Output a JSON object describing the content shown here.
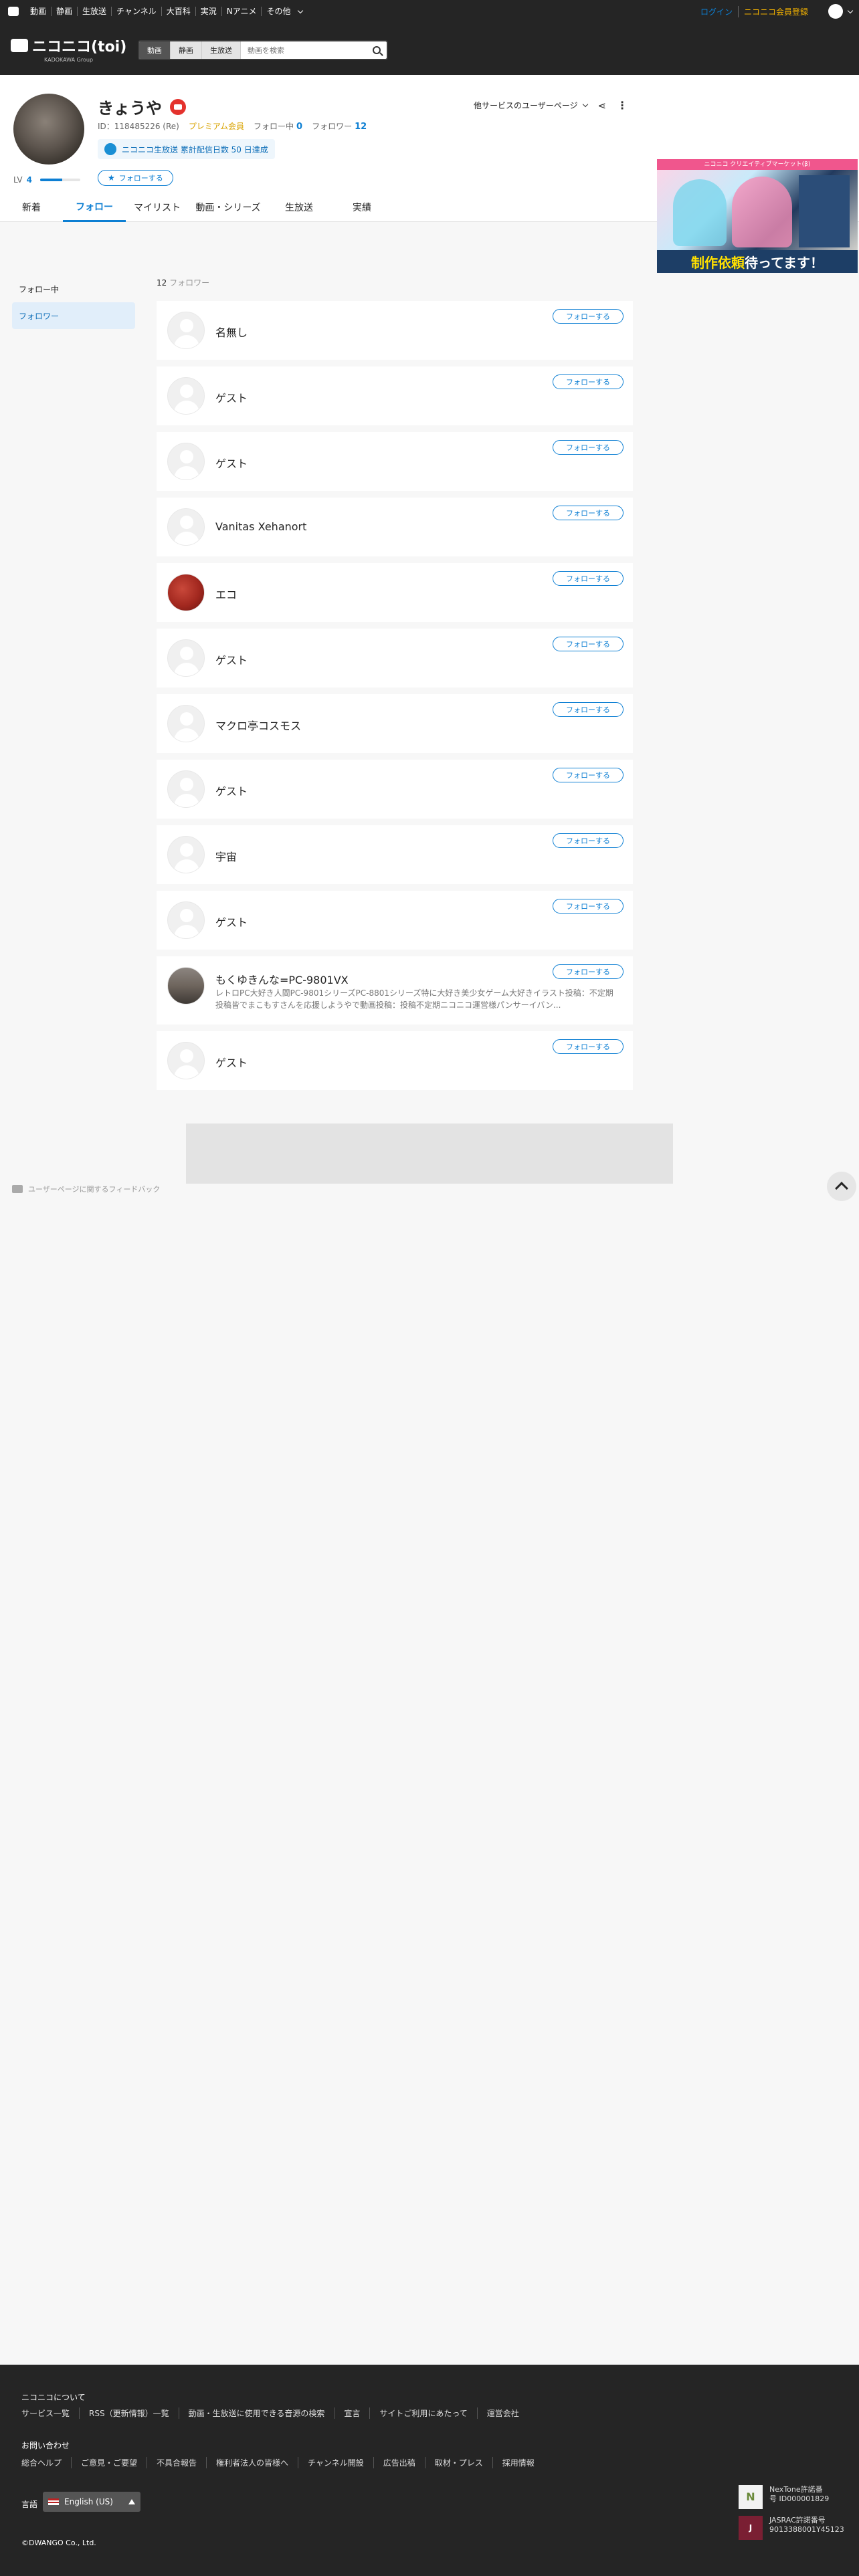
{
  "global_nav": {
    "items": [
      "動画",
      "静画",
      "生放送",
      "チャンネル",
      "大百科",
      "実況",
      "Nアニメ",
      "その他"
    ],
    "login": "ログイン",
    "signup": "ニコニコ会員登録"
  },
  "brand": {
    "name": "ニコニコ(toi)",
    "sub": "KADOKAWA Group"
  },
  "search": {
    "tabs": [
      "動画",
      "静画",
      "生放送"
    ],
    "placeholder": "動画を検索"
  },
  "profile": {
    "name": "きょうや",
    "id_label": "ID：118485226 (Re)",
    "premium": "プレミアム会員",
    "following_label": "フォロー中",
    "following_count": "0",
    "followers_label": "フォロワー",
    "followers_count": "12",
    "badge_text": "ニコニコ生放送 累計配信日数 50 日達成",
    "level_label": "LV",
    "level": "4",
    "level_progress": 0.55,
    "follow_button": "フォローする",
    "other_services": "他サービスのユーザーページ"
  },
  "tabs": [
    "新着",
    "フォロー",
    "マイリスト",
    "動画・シリーズ",
    "生放送",
    "実績"
  ],
  "active_tab": "フォロー",
  "ad_banner": {
    "top": "ニコニコ クリエイティブマーケット(β)",
    "bottom_a": "制作依頼",
    "bottom_b": "待ってます！"
  },
  "sidebar": [
    "フォロー中",
    "フォロワー"
  ],
  "list_header": {
    "count": "12",
    "label": "フォロワー"
  },
  "follow_label": "フォローする",
  "followers": [
    {
      "name": "名無し",
      "desc": ""
    },
    {
      "name": "ゲスト",
      "desc": ""
    },
    {
      "name": "ゲスト",
      "desc": ""
    },
    {
      "name": "Vanitas Xehanort",
      "desc": ""
    },
    {
      "name": "エコ",
      "desc": ""
    },
    {
      "name": "ゲスト",
      "desc": ""
    },
    {
      "name": "マクロ亭コスモス",
      "desc": ""
    },
    {
      "name": "ゲスト",
      "desc": ""
    },
    {
      "name": "宇宙",
      "desc": ""
    },
    {
      "name": "ゲスト",
      "desc": ""
    },
    {
      "name": "もくゆきんな=PC-9801VX",
      "desc": "レトロPC大好き人間PC-9801シリーズPC-8801シリーズ特に大好き美少女ゲーム大好きイラスト投稿：不定期投稿皆でまこもすさんを応援しようやで動画投稿：投稿不定期ニコニコ運営様パンサーイバン..."
    },
    {
      "name": "ゲスト",
      "desc": ""
    }
  ],
  "feedback": "ユーザーページに関するフィードバック",
  "footer": {
    "about_title": "ニコニコについて",
    "about_links": [
      "サービス一覧",
      "RSS（更新情報）一覧",
      "動画・生放送に使用できる音源の検索",
      "宣言",
      "サイトご利用にあたって",
      "運営会社"
    ],
    "contact_title": "お問い合わせ",
    "contact_links": [
      "総合ヘルプ",
      "ご意見・ご要望",
      "不具合報告",
      "権利者法人の皆様へ",
      "チャンネル開設",
      "広告出稿",
      "取材・プレス",
      "採用情報"
    ],
    "lang_label": "言語",
    "lang_value": "English (US)",
    "copyright": "©DWANGO Co., Ltd.",
    "nextone": "NexTone許諾番号 ID000001829",
    "jasrac": "JASRAC許諾番号 9013388001Y45123"
  }
}
